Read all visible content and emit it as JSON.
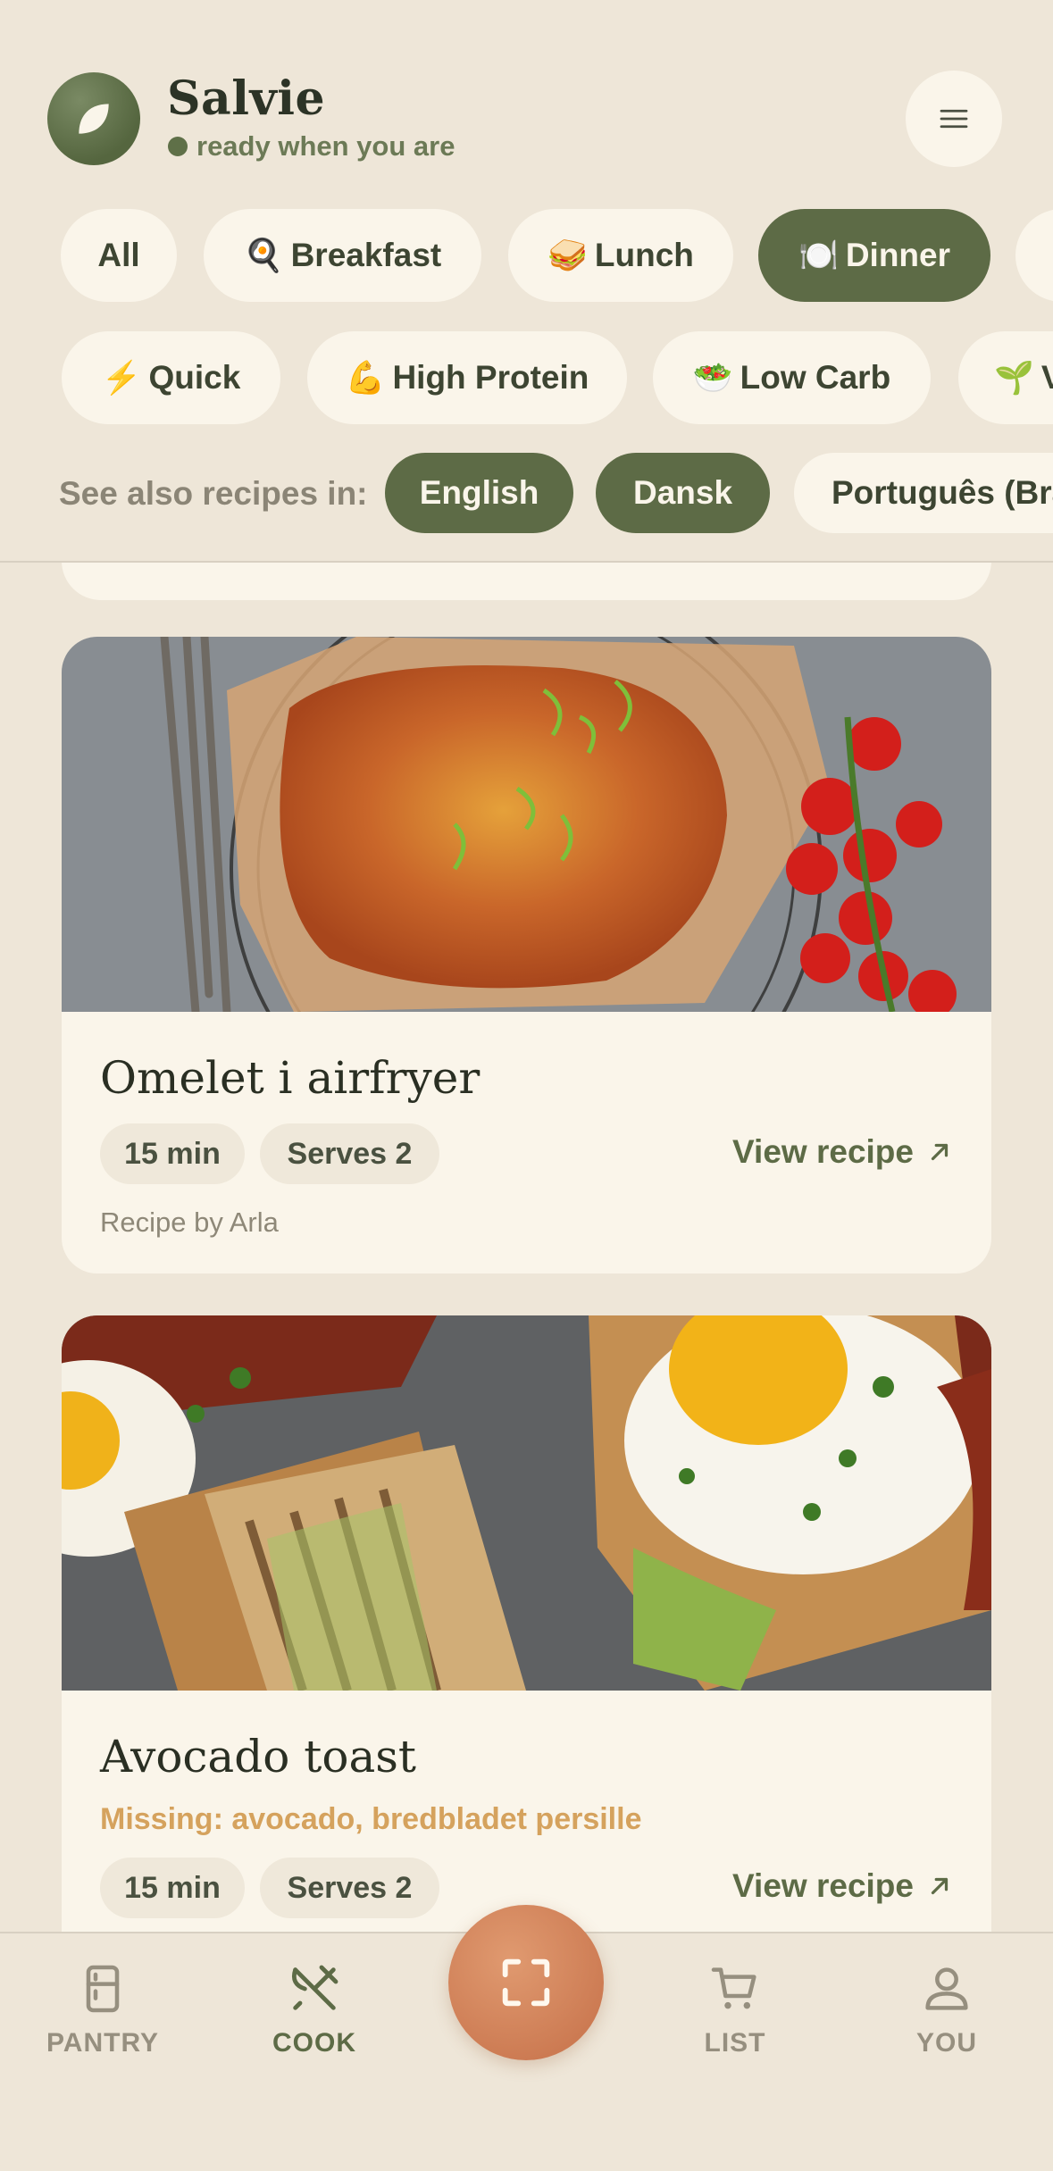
{
  "app": {
    "title": "Salvie",
    "tagline": "ready when you are"
  },
  "meal_filters": [
    {
      "label": "All",
      "emoji": "",
      "active": false
    },
    {
      "label": "Breakfast",
      "emoji": "🍳",
      "active": false
    },
    {
      "label": "Lunch",
      "emoji": "🥪",
      "active": false
    },
    {
      "label": "Dinner",
      "emoji": "🍽️",
      "active": true
    }
  ],
  "diet_filters": [
    {
      "label": "Quick",
      "emoji": "⚡"
    },
    {
      "label": "High Protein",
      "emoji": "💪"
    },
    {
      "label": "Low Carb",
      "emoji": "🥗"
    },
    {
      "label": "V",
      "emoji": "🌱"
    }
  ],
  "languages": {
    "label": "See also recipes in:",
    "items": [
      {
        "label": "English",
        "active": true
      },
      {
        "label": "Dansk",
        "active": true
      },
      {
        "label": "Português (Bra",
        "active": false
      }
    ]
  },
  "recipes": [
    {
      "title": "Omelet i airfryer",
      "time": "15 min",
      "serves": "Serves 2",
      "view_label": "View recipe",
      "credit": "Recipe by Arla",
      "missing": ""
    },
    {
      "title": "Avocado toast",
      "time": "15 min",
      "serves": "Serves 2",
      "view_label": "View recipe",
      "credit": "",
      "missing": "Missing: avocado, bredbladet persille"
    }
  ],
  "nav": {
    "pantry": "PANTRY",
    "cook": "COOK",
    "list": "LIST",
    "you": "YOU",
    "active": "cook"
  },
  "colors": {
    "background": "#eee6d8",
    "card": "#faf5ea",
    "accent_green": "#5d6b46",
    "accent_orange": "#cc7a52",
    "missing_text": "#d5a25d"
  }
}
